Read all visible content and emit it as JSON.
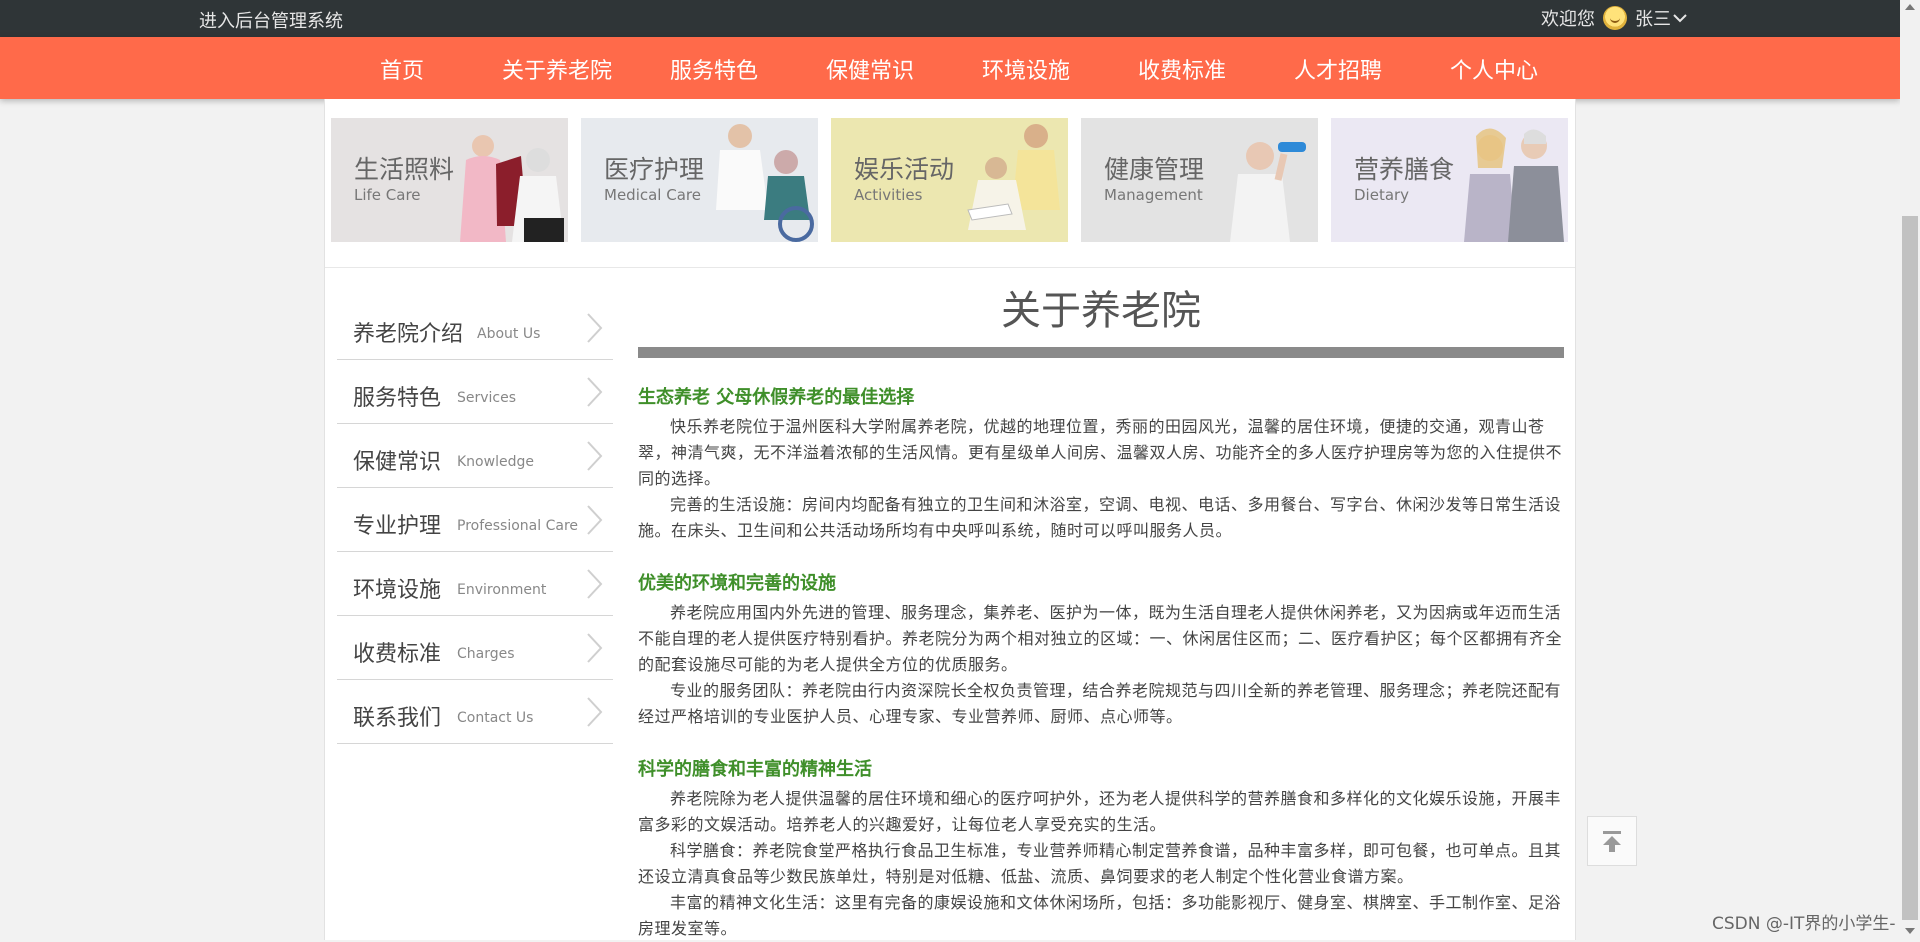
{
  "topbar": {
    "admin_link": "进入后台管理系统",
    "welcome": "欢迎您",
    "username": "张三"
  },
  "nav": {
    "items": [
      "首页",
      "关于养老院",
      "服务特色",
      "保健常识",
      "环境设施",
      "收费标准",
      "人才招聘",
      "个人中心"
    ]
  },
  "banners": [
    {
      "zh": "生活照料",
      "en": "Life Care",
      "bg": "#e5e2e2",
      "icon": "caregiver-photo"
    },
    {
      "zh": "医疗护理",
      "en": "Medical Care",
      "bg": "#e7eaee",
      "icon": "nurse-photo"
    },
    {
      "zh": "娱乐活动",
      "en": "Activities",
      "bg": "#ece7b0",
      "icon": "reading-elders-photo"
    },
    {
      "zh": "健康管理",
      "en": "Management",
      "bg": "#e3e3e3",
      "icon": "dumbbell-elder-photo"
    },
    {
      "zh": "营养膳食",
      "en": "Dietary",
      "bg": "#ebe8f3",
      "icon": "elder-couple-photo"
    }
  ],
  "sidebar": {
    "items": [
      {
        "zh": "养老院介绍",
        "en": "About Us"
      },
      {
        "zh": "服务特色",
        "en": "Services"
      },
      {
        "zh": "保健常识",
        "en": "Knowledge"
      },
      {
        "zh": "专业护理",
        "en": "Professional Care"
      },
      {
        "zh": "环境设施",
        "en": "Environment"
      },
      {
        "zh": "收费标准",
        "en": "Charges"
      },
      {
        "zh": "联系我们",
        "en": "Contact Us"
      }
    ]
  },
  "content": {
    "title": "关于养老院",
    "sections": [
      {
        "heading": "生态养老 父母休假养老的最佳选择",
        "paragraphs": [
          "快乐养老院位于温州医科大学附属养老院，优越的地理位置，秀丽的田园风光，温馨的居住环境，便捷的交通，观青山苍翠，神清气爽，无不洋溢着浓郁的生活风情。更有星级单人间房、温馨双人房、功能齐全的多人医疗护理房等为您的入住提供不同的选择。",
          "完善的生活设施：房间内均配备有独立的卫生间和沐浴室，空调、电视、电话、多用餐台、写字台、休闲沙发等日常生活设施。在床头、卫生间和公共活动场所均有中央呼叫系统，随时可以呼叫服务人员。"
        ]
      },
      {
        "heading": "优美的环境和完善的设施",
        "paragraphs": [
          "养老院应用国内外先进的管理、服务理念，集养老、医护为一体，既为生活自理老人提供休闲养老，又为因病或年迈而生活不能自理的老人提供医疗特别看护。养老院分为两个相对独立的区域：一、休闲居住区而；二、医疗看护区；每个区都拥有齐全的配套设施尽可能的为老人提供全方位的优质服务。",
          "专业的服务团队：养老院由行内资深院长全权负责管理，结合养老院规范与四川全新的养老管理、服务理念；养老院还配有经过严格培训的专业医护人员、心理专家、专业营养师、厨师、点心师等。"
        ]
      },
      {
        "heading": "科学的膳食和丰富的精神生活",
        "paragraphs": [
          "养老院除为老人提供温馨的居住环境和细心的医疗呵护外，还为老人提供科学的营养膳食和多样化的文化娱乐设施，开展丰富多彩的文娱活动。培养老人的兴趣爱好，让每位老人享受充实的生活。",
          "科学膳食：养老院食堂严格执行食品卫生标准，专业营养师精心制定营养食谱，品种丰富多样，即可包餐，也可单点。且其还设立清真食品等少数民族单灶，特别是对低糖、低盐、流质、鼻饲要求的老人制定个性化营业食谱方案。",
          "丰富的精神文化生活：这里有完备的康娱设施和文体休闲场所，包括：多功能影视厅、健身室、棋牌室、手工制作室、足浴房理发室等。"
        ]
      }
    ]
  },
  "watermark": "CSDN @-IT界的小学生-",
  "colors": {
    "nav": "#ff6a4a",
    "topbar": "#2f3537",
    "heading_green": "#3f8f2a"
  }
}
